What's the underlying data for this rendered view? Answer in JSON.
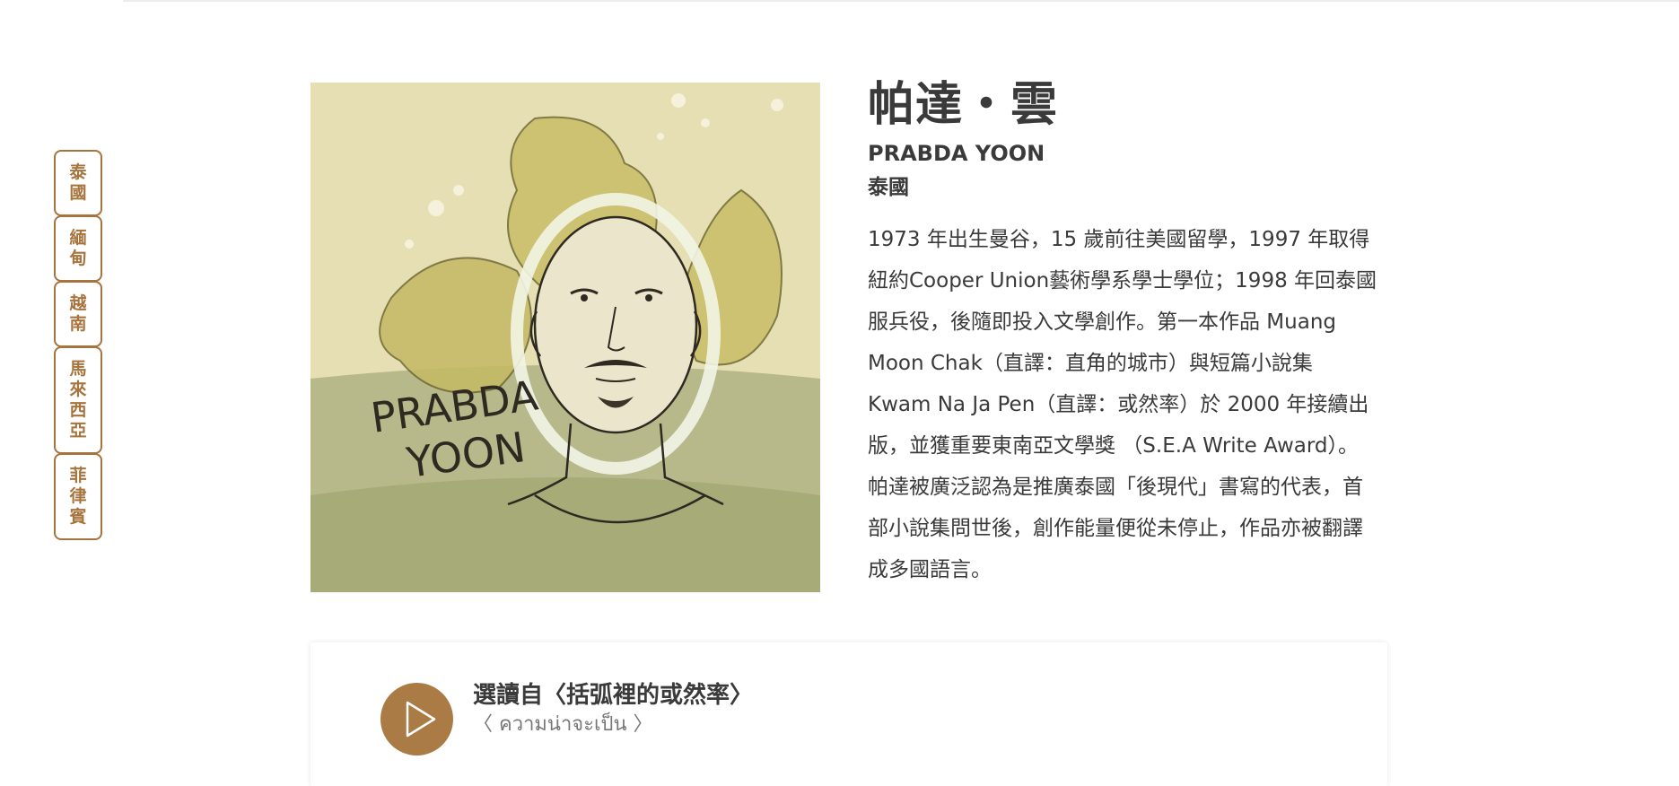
{
  "side_nav": {
    "items": [
      {
        "label_chars": [
          "泰",
          "國"
        ]
      },
      {
        "label_chars": [
          "緬",
          "甸"
        ]
      },
      {
        "label_chars": [
          "越",
          "南"
        ]
      },
      {
        "label_chars": [
          "馬",
          "來",
          "西",
          "亞"
        ]
      },
      {
        "label_chars": [
          "菲",
          "律",
          "賓"
        ]
      }
    ],
    "accent_color": "#a8743d"
  },
  "author": {
    "name_zh": "帕達・雲",
    "name_en": "PRABDA YOON",
    "country": "泰國",
    "portrait_signature": "PRABDA YOON",
    "bio_lines": [
      "1973 年出生曼谷，15 歲前往美國留學，1997 年取得",
      "紐約Cooper Union藝術學系學士學位；1998 年回泰國",
      "服兵役，後隨即投入文學創作。第一本作品 Muang",
      "Moon Chak（直譯：直角的城市）與短篇小說集",
      "Kwam Na Ja Pen（直譯：或然率）於 2000 年接續出",
      "版，並獲重要東南亞文學獎 （S.E.A Write Award）。",
      "帕達被廣泛認為是推廣泰國「後現代」書寫的代表，首",
      "部小說集問世後，創作能量便從未停止，作品亦被翻譯",
      "成多國語言。"
    ]
  },
  "reading": {
    "title": "選讀自〈括弧裡的或然率〉",
    "subtitle": "〈 ความน่าจะเป็น 〉",
    "play_icon": "play-icon",
    "button_color": "#ab7b46"
  }
}
